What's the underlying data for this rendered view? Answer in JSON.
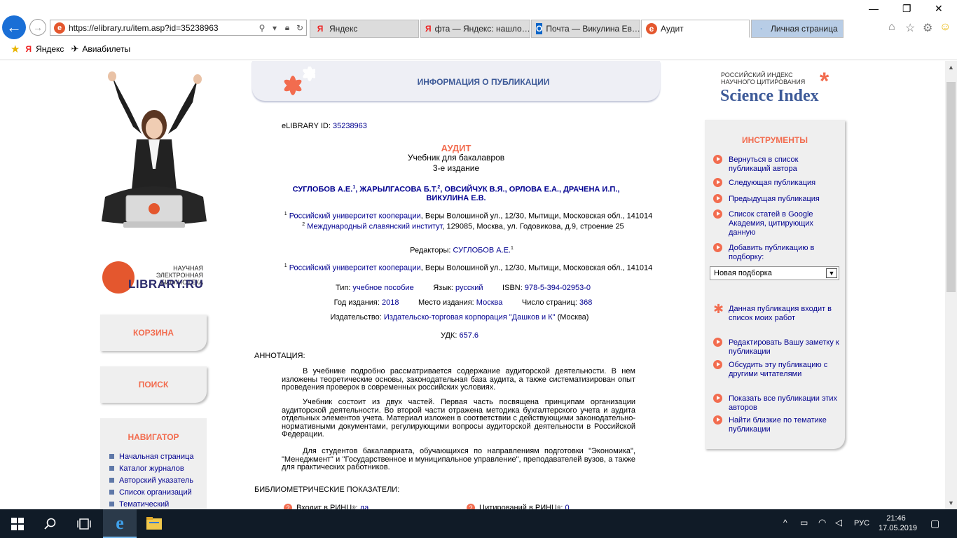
{
  "browser": {
    "url": "https://elibrary.ru/item.asp?id=35238963",
    "tabs": [
      {
        "label": "Яндекс",
        "icon": "Я"
      },
      {
        "label": "фта — Яндекс: нашло…",
        "icon": "Я"
      },
      {
        "label": "Почта — Викулина Ев…",
        "icon": "O"
      },
      {
        "label": "Аудит",
        "icon": "e"
      },
      {
        "label": "Личная страница",
        "icon": "·"
      }
    ],
    "favorites": [
      "Яндекс",
      "Авиабилеты"
    ]
  },
  "left": {
    "logo_line1": "НАУЧНАЯ ЭЛЕКТРОННАЯ",
    "logo_line2": "БИБЛИОТЕКА",
    "logo_brand": "LIBRARY.RU",
    "cart": "КОРЗИНА",
    "search": "ПОИСК",
    "navigator_title": "НАВИГАТОР",
    "nav": [
      "Начальная страница",
      "Каталог журналов",
      "Авторский указатель",
      "Список организаций",
      "Тематический"
    ]
  },
  "banner_title": "ИНФОРМАЦИЯ О ПУБЛИКАЦИИ",
  "rsci": {
    "l1": "РОССИЙСКИЙ ИНДЕКС",
    "l2": "НАУЧНОГО ЦИТИРОВАНИЯ",
    "brand": "Science Index"
  },
  "pub": {
    "id_label": "eLIBRARY ID:",
    "id": "35238963",
    "title": "АУДИТ",
    "subtitle": "Учебник для бакалавров",
    "edition": "3-е издание",
    "authors_line1": [
      "СУГЛОБОВ А.Е.",
      "ЖАРЫЛГАСОВА Б.Т.",
      "ОВСИЙЧУК В.Я.",
      "ОРЛОВА Е.А.",
      "ДРАЧЕНА И.П."
    ],
    "authors_line2": "ВИКУЛИНА Е.В.",
    "aff1_org": "Российский университет кооперации",
    "aff1_rest": ", Веры Волошиной ул., 12/30, Мытищи, Московская обл., 141014",
    "aff2_org": "Международный славянский институт",
    "aff2_rest": ", 129085, Москва, ул. Годовикова, д.9, строение 25",
    "editors_label": "Редакторы:",
    "editor": "СУГЛОБОВ А.Е.",
    "ed_aff_org": "Российский университет кооперации",
    "ed_aff_rest": ", Веры Волошиной ул., 12/30, Мытищи, Московская обл., 141014",
    "type_label": "Тип:",
    "type": "учебное пособие",
    "lang_label": "Язык:",
    "lang": "русский",
    "isbn_label": "ISBN:",
    "isbn": "978-5-394-02953-0",
    "year_label": "Год издания:",
    "year": "2018",
    "place_label": "Место издания:",
    "place": "Москва",
    "pages_label": "Число страниц:",
    "pages": "368",
    "publisher_label": "Издательство:",
    "publisher": "Издательско-торговая корпорация \"Дашков и К\"",
    "publisher_city": " (Москва)",
    "udk_label": "УДК:",
    "udk": "657.6",
    "annotation_label": "АННОТАЦИЯ:",
    "ann_p1": "В учебнике подробно рассматривается содержание аудиторской деятельности. В нем изложены теоретические основы, законодательная база аудита, а также систематизирован опыт проведения проверок в современных российских условиях.",
    "ann_p2": "Учебник состоит из двух частей. Первая часть посвящена принципам организации аудиторской деятельности. Во второй части отражена методика бухгалтерского учета и аудита отдельных элементов учета. Материал изложен в соответствии с действующими законодательно-нормативными документами, регулирующими вопросы аудиторской деятельности в Российской Федерации.",
    "ann_p3": "Для студентов бакалавриата, обучающихся по направлениям подготовки \"Экономика\", \"Менеджмент\" и \"Государственное и муниципальное управление\", преподавателей вузов, а также для практических работников.",
    "biblio_label": "БИБЛИОМЕТРИЧЕСКИЕ ПОКАЗАТЕЛИ:",
    "rinc_label": "Входит в РИНЦ",
    "rinc_val": "да",
    "cit_label": "Цитирований в РИНЦ",
    "cit_val": "0"
  },
  "tools": {
    "title": "ИНСТРУМЕНТЫ",
    "items": [
      "Вернуться в список публикаций автора",
      "Следующая публикация",
      "Предыдущая публикация",
      "Список статей в Google Академия, цитирующих данную",
      "Добавить публикацию в подборку:"
    ],
    "select": "Новая подборка",
    "mywork": "Данная публикация входит в список моих работ",
    "items2": [
      "Редактировать Вашу заметку к публикации",
      "Обсудить эту публикацию с другими читателями",
      "Показать все публикации этих авторов",
      "Найти близкие по тематике публикации"
    ]
  },
  "taskbar": {
    "lang": "РУС",
    "time": "21:46",
    "date": "17.05.2019"
  }
}
